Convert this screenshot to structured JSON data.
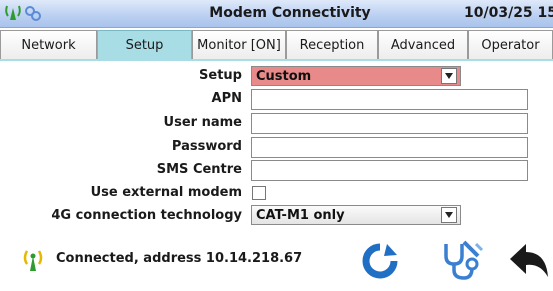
{
  "window": {
    "title": "Modem Connectivity",
    "datetime": "10/03/25 15:5"
  },
  "tabs": [
    {
      "label": "Network",
      "active": false
    },
    {
      "label": "Setup",
      "active": true
    },
    {
      "label": "Monitor [ON]",
      "active": false
    },
    {
      "label": "Reception",
      "active": false
    },
    {
      "label": "Advanced",
      "active": false
    },
    {
      "label": "Operator",
      "active": false
    }
  ],
  "form": {
    "setup_label": "Setup",
    "setup_value": "Custom",
    "apn_label": "APN",
    "apn_value": "",
    "username_label": "User name",
    "username_value": "",
    "password_label": "Password",
    "password_value": "",
    "sms_label": "SMS Centre",
    "sms_value": "",
    "external_modem_label": "Use external modem",
    "external_modem_checked": false,
    "tech_label": "4G connection technology",
    "tech_value": "CAT-M1 only"
  },
  "status": {
    "text": "Connected, address 10.14.218.67"
  },
  "colors": {
    "titlebar": "#bcd1f2",
    "active_tab": "#a8dde6",
    "setup_select": "#e88a8a",
    "signal_green": "#2e9b2e",
    "refresh_blue": "#1f6fc4",
    "diagnose_blue": "#3a7fd0"
  },
  "icons": {
    "signal": "signal-antenna-icon",
    "refresh": "refresh-icon",
    "diagnose": "stethoscope-icon",
    "back": "back-arrow-icon"
  }
}
